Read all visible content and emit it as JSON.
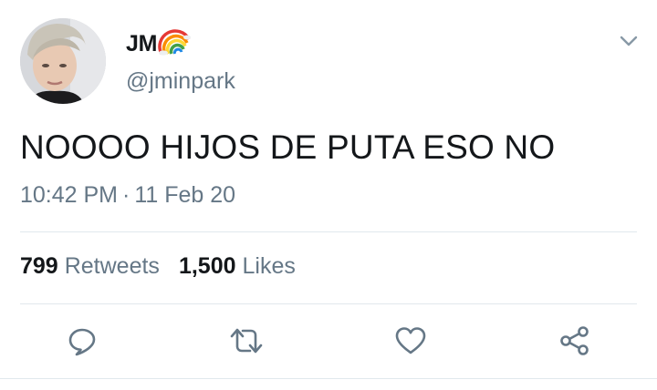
{
  "tweet": {
    "display_name": "JM",
    "handle": "@jminpark",
    "text": "NOOOO HIJOS DE PUTA ESO NO",
    "time": "10:42 PM",
    "separator": "·",
    "date": "11 Feb 20",
    "stats": {
      "retweets_count": "799",
      "retweets_label": "Retweets",
      "likes_count": "1,500",
      "likes_label": "Likes"
    }
  },
  "icons": {
    "name_badge": "rainbow-icon",
    "more": "chevron-down-icon",
    "reply": "reply-icon",
    "retweet": "retweet-icon",
    "like": "heart-icon",
    "share": "share-icon"
  },
  "colors": {
    "text_primary": "#14171a",
    "text_secondary": "#657786",
    "icon": "#657786",
    "divider": "#e1e8ed",
    "background": "#ffffff"
  }
}
